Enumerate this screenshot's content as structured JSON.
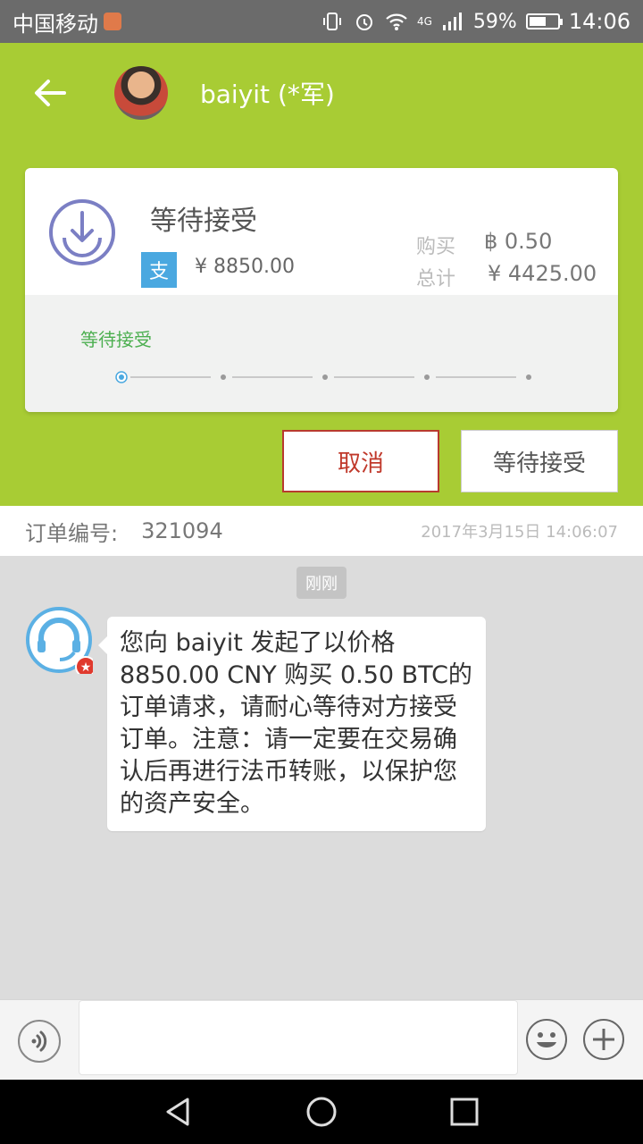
{
  "status_bar": {
    "carrier": "中国移动",
    "network": "4G",
    "battery_percent": "59%",
    "battery_level": 0.59,
    "time": "14:06"
  },
  "header": {
    "title": "baiyit (*军)"
  },
  "order_card": {
    "status_title": "等待接受",
    "pay_badge": "支",
    "price": "¥ 8850.00",
    "buy_label": "购买",
    "buy_value": "฿ 0.50",
    "total_label": "总计",
    "total_value": "¥ 4425.00",
    "progress_label": "等待接受",
    "progress_steps_total": 5,
    "progress_current_step": 1
  },
  "actions": {
    "cancel_label": "取消",
    "wait_label": "等待接受"
  },
  "order_info": {
    "label": "订单编号:",
    "number": "321094",
    "time": "2017年3月15日 14:06:07"
  },
  "chat": {
    "time_chip": "刚刚",
    "message": "您向 baiyit 发起了以价格 8850.00 CNY 购买 0.50 BTC的订单请求，请耐心等待对方接受订单。注意：请一定要在交易确认后再进行法币转账，以保护您的资产安全。"
  },
  "input_bar": {
    "placeholder": ""
  },
  "colors": {
    "brand_green": "#a8cc34",
    "cancel_red": "#c0392b",
    "accent_blue": "#4aa8e0",
    "icon_purple": "#7b7fc4"
  },
  "icons": {
    "back": "arrow-left-icon",
    "status": "download-circle-icon",
    "voice": "voice-icon",
    "emoji": "smiley-icon",
    "plus": "plus-icon"
  }
}
